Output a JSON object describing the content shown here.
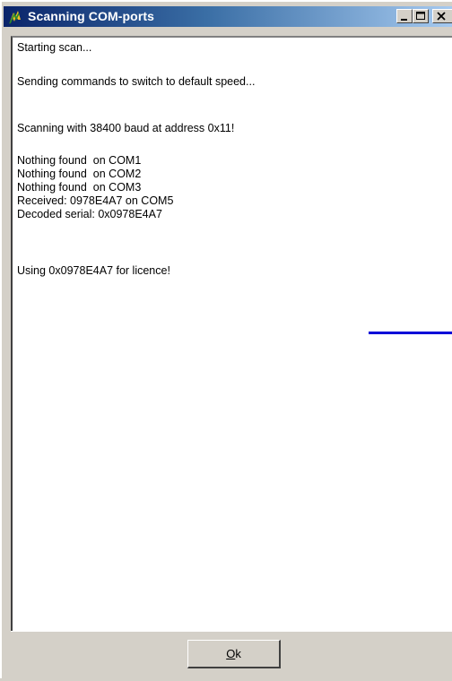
{
  "window": {
    "title": "Scanning COM-ports"
  },
  "log_lines": [
    "Starting scan...",
    "Sending commands to switch to default speed...",
    "Scanning with 38400 baud at address 0x11!",
    "Nothing found  on COM1",
    "Nothing found  on COM2",
    "Nothing found  on COM3",
    "Received: 0978E4A7 on COM5",
    "Decoded serial: 0x0978E4A7",
    "Using 0x0978E4A7 for licence!"
  ],
  "ok_button": {
    "mnemonic": "O",
    "rest": "k"
  },
  "colors": {
    "titlebar_start": "#0a246a",
    "titlebar_end": "#a6caf0",
    "dialog_face": "#d4d0c8",
    "accent_line": "#0000d8"
  },
  "icons": {
    "app": "app-icon",
    "minimize": "minimize-icon",
    "maximize": "maximize-icon",
    "close": "close-icon"
  }
}
